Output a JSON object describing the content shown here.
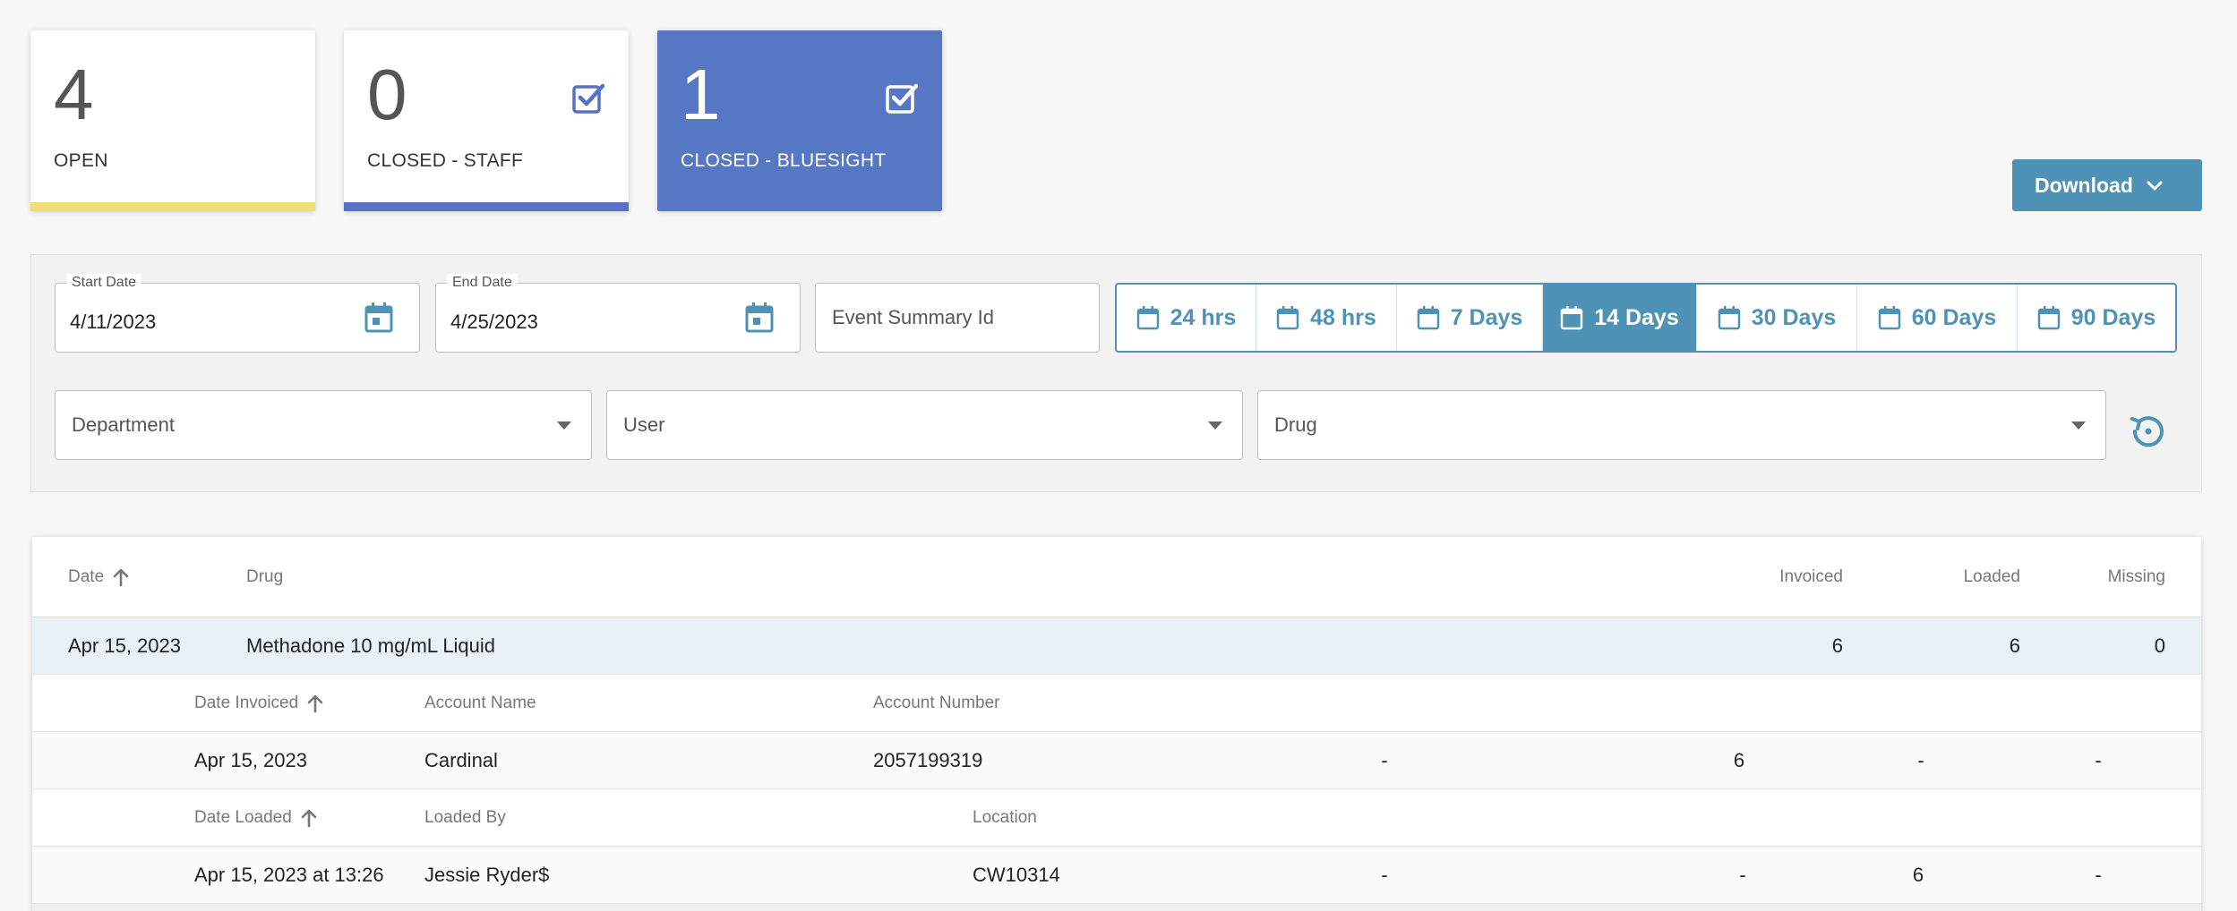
{
  "cards": {
    "open": {
      "count": "4",
      "label": "OPEN"
    },
    "staff": {
      "count": "0",
      "label": "CLOSED - STAFF"
    },
    "bluesight": {
      "count": "1",
      "label": "CLOSED - BLUESIGHT"
    }
  },
  "download": {
    "label": "Download"
  },
  "filters": {
    "start_date": {
      "label": "Start Date",
      "value": "4/11/2023"
    },
    "end_date": {
      "label": "End Date",
      "value": "4/25/2023"
    },
    "event_summary": {
      "placeholder": "Event Summary Id"
    },
    "ranges": [
      "24 hrs",
      "48 hrs",
      "7 Days",
      "14 Days",
      "30 Days",
      "60 Days",
      "90 Days"
    ],
    "active_range": "14 Days",
    "department": "Department",
    "user": "User",
    "drug": "Drug"
  },
  "table": {
    "headers": {
      "date": "Date",
      "drug": "Drug",
      "invoiced": "Invoiced",
      "loaded": "Loaded",
      "missing": "Missing"
    },
    "row": {
      "date": "Apr 15, 2023",
      "drug": "Methadone 10 mg/mL Liquid",
      "invoiced": "6",
      "loaded": "6",
      "missing": "0"
    },
    "invoice_headers": {
      "date": "Date Invoiced",
      "account_name": "Account Name",
      "account_number": "Account Number"
    },
    "invoice_row": {
      "date": "Apr 15, 2023",
      "account_name": "Cardinal",
      "account_number": "2057199319",
      "c1": "-",
      "invoiced": "6",
      "loaded": "-",
      "missing": "-"
    },
    "loaded_headers": {
      "date": "Date Loaded",
      "loaded_by": "Loaded By",
      "location": "Location"
    },
    "loaded_row": {
      "date": "Apr 15, 2023 at 13:26",
      "loaded_by": "Jessie Ryder$",
      "location": "CW10314",
      "c1": "-",
      "invoiced": "-",
      "loaded": "6",
      "missing": "-"
    }
  },
  "colors": {
    "accent": "#4e93b5",
    "bluesight": "#5677c3",
    "open_bar": "#f2de78"
  }
}
